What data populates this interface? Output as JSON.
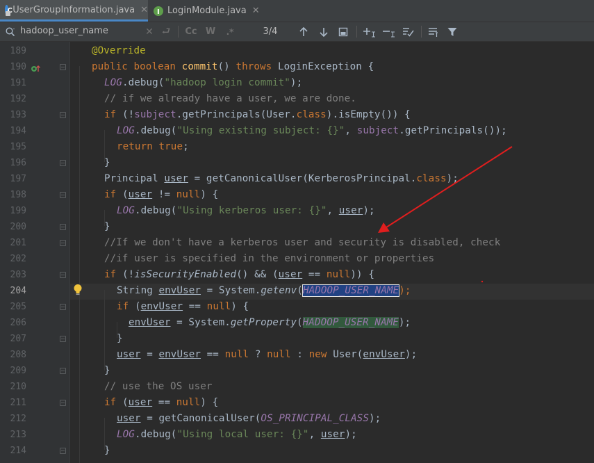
{
  "tabs": [
    {
      "label": "UserGroupInformation.java",
      "active": true,
      "icon": "class-icon"
    },
    {
      "label": "LoginModule.java",
      "active": false,
      "icon": "interface-icon"
    }
  ],
  "search": {
    "value": "hadoop_user_name",
    "match_counter": "3/4",
    "match_case": "Cc",
    "whole_words": "W",
    "regex": ".*"
  },
  "editor": {
    "current_line": "204",
    "lines": [
      {
        "n": "189"
      },
      {
        "n": "190"
      },
      {
        "n": "191"
      },
      {
        "n": "192"
      },
      {
        "n": "193"
      },
      {
        "n": "194"
      },
      {
        "n": "195"
      },
      {
        "n": "196"
      },
      {
        "n": "197"
      },
      {
        "n": "198"
      },
      {
        "n": "199"
      },
      {
        "n": "200"
      },
      {
        "n": "201"
      },
      {
        "n": "202"
      },
      {
        "n": "203"
      },
      {
        "n": "204"
      },
      {
        "n": "205"
      },
      {
        "n": "206"
      },
      {
        "n": "207"
      },
      {
        "n": "208"
      },
      {
        "n": "209"
      },
      {
        "n": "210"
      },
      {
        "n": "211"
      },
      {
        "n": "212"
      },
      {
        "n": "213"
      },
      {
        "n": "214"
      }
    ],
    "code": {
      "l189": {
        "annotation": "@Override"
      },
      "l190": {
        "kw1": "public",
        "kw2": "boolean",
        "method": "commit",
        "p1": "() ",
        "kw3": "throws",
        "rest": " LoginException {"
      },
      "l191": {
        "log": "LOG",
        "a": ".debug(",
        "s": "\"hadoop login commit\"",
        "b": ");"
      },
      "l192": {
        "comment": "// if we already have a user, we are done."
      },
      "l193": {
        "kw": "if",
        "a": " (!",
        "f": "subject",
        "b": ".getPrincipals(User.",
        "kw2": "class",
        "c": ").isEmpty()) {"
      },
      "l194": {
        "log": "LOG",
        "a": ".debug(",
        "s": "\"Using existing subject: {}\"",
        "b": ", ",
        "f": "subject",
        "c": ".getPrincipals());"
      },
      "l195": {
        "kw": "return",
        "a": " ",
        "kw2": "true",
        "b": ";"
      },
      "l196": {
        "a": "}"
      },
      "l197": {
        "a": "Principal ",
        "u": "user",
        "b": " = getCanonicalUser(KerberosPrincipal.",
        "kw": "class",
        "c": ");"
      },
      "l198": {
        "kw": "if",
        "a": " (",
        "u": "user",
        "b": " != ",
        "kw2": "null",
        "c": ") {"
      },
      "l199": {
        "log": "LOG",
        "a": ".debug(",
        "s": "\"Using kerberos user: {}\"",
        "b": ", ",
        "u": "user",
        "c": ");"
      },
      "l200": {
        "a": "}"
      },
      "l201": {
        "comment": "//If we don't have a kerberos user and security is disabled, check"
      },
      "l202": {
        "comment": "//if user is specified in the environment or properties"
      },
      "l203": {
        "kw": "if",
        "a": " (!",
        "it": "isSecurityEnabled",
        "b": "() && (",
        "u": "user",
        "c": " == ",
        "kw2": "null",
        "d": ")) {"
      },
      "l204": {
        "a": "String ",
        "u": "envUser",
        "b": " = System.",
        "it": "getenv",
        "c": "(",
        "hl": "HADOOP_USER_NAME",
        "d": ");"
      },
      "l205": {
        "kw": "if",
        "a": " (",
        "u": "envUser",
        "b": " == ",
        "kw2": "null",
        "c": ") {"
      },
      "l206": {
        "u": "envUser",
        "a": " = System.",
        "it": "getProperty",
        "b": "(",
        "hl": "HADOOP_USER_NAME",
        "c": ");"
      },
      "l207": {
        "a": "}"
      },
      "l208": {
        "u": "user",
        "a": " = ",
        "u2": "envUser",
        "b": " == ",
        "kw": "null",
        "c": " ? ",
        "kw2": "null",
        "d": " : ",
        "kw3": "new",
        "e": " User(",
        "u3": "envUser",
        "f": ");"
      },
      "l209": {
        "a": "}"
      },
      "l210": {
        "comment": "// use the OS user"
      },
      "l211": {
        "kw": "if",
        "a": " (",
        "u": "user",
        "b": " == ",
        "kw2": "null",
        "c": ") {"
      },
      "l212": {
        "u": "user",
        "a": " = getCanonicalUser(",
        "fi": "OS_PRINCIPAL_CLASS",
        "b": ");"
      },
      "l213": {
        "log": "LOG",
        "a": ".debug(",
        "s": "\"Using local user: {}\"",
        "b": ", ",
        "u": "user",
        "c": ");"
      },
      "l214": {
        "a": "}"
      }
    }
  },
  "colors": {
    "keyword": "#cc7832",
    "string": "#6a8759",
    "comment": "#808080",
    "field": "#9876aa",
    "method": "#ffc66d",
    "annotation": "#bbb529",
    "arrow": "#e01e1e"
  }
}
